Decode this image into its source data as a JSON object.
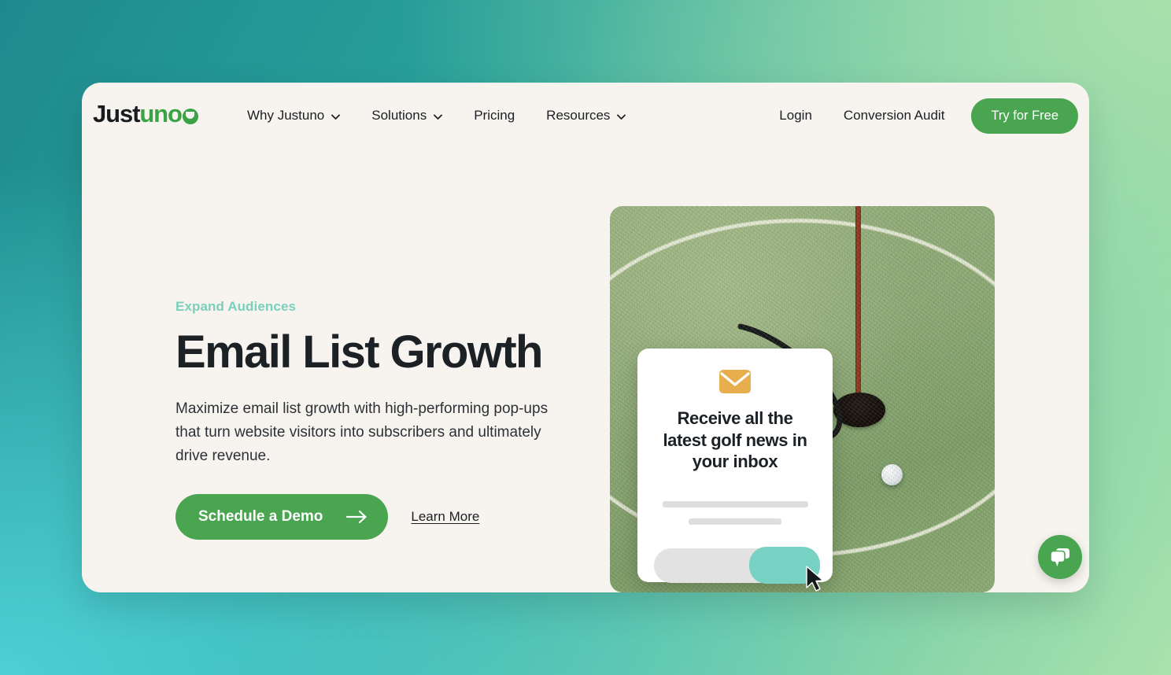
{
  "brand": {
    "logo_text_dark": "Just",
    "logo_text_green": "uno",
    "green": "#3aa345",
    "cta_green": "#4aa551",
    "eyebrow_teal": "#7bd0bd",
    "page_bg": "#f7f4ef"
  },
  "nav": {
    "items": [
      {
        "label": "Why Justuno",
        "has_chevron": true
      },
      {
        "label": "Solutions",
        "has_chevron": true
      },
      {
        "label": "Pricing",
        "has_chevron": false
      },
      {
        "label": "Resources",
        "has_chevron": true
      }
    ],
    "login_label": "Login",
    "conversion_audit_label": "Conversion Audit",
    "try_free_label": "Try for Free"
  },
  "hero": {
    "eyebrow": "Expand Audiences",
    "title": "Email List Growth",
    "body": "Maximize email list growth with high-performing pop-ups that turn website visitors into subscribers and ultimately drive revenue.",
    "primary_cta": "Schedule a Demo",
    "secondary_cta": "Learn More"
  },
  "popup": {
    "title": "Receive all the latest golf news in your inbox",
    "envelope_color": "#e8ae4e",
    "submit_color": "#78d2c4",
    "input_placeholder": ""
  },
  "chat": {
    "label": "chat-widget",
    "color": "#4aa551"
  }
}
